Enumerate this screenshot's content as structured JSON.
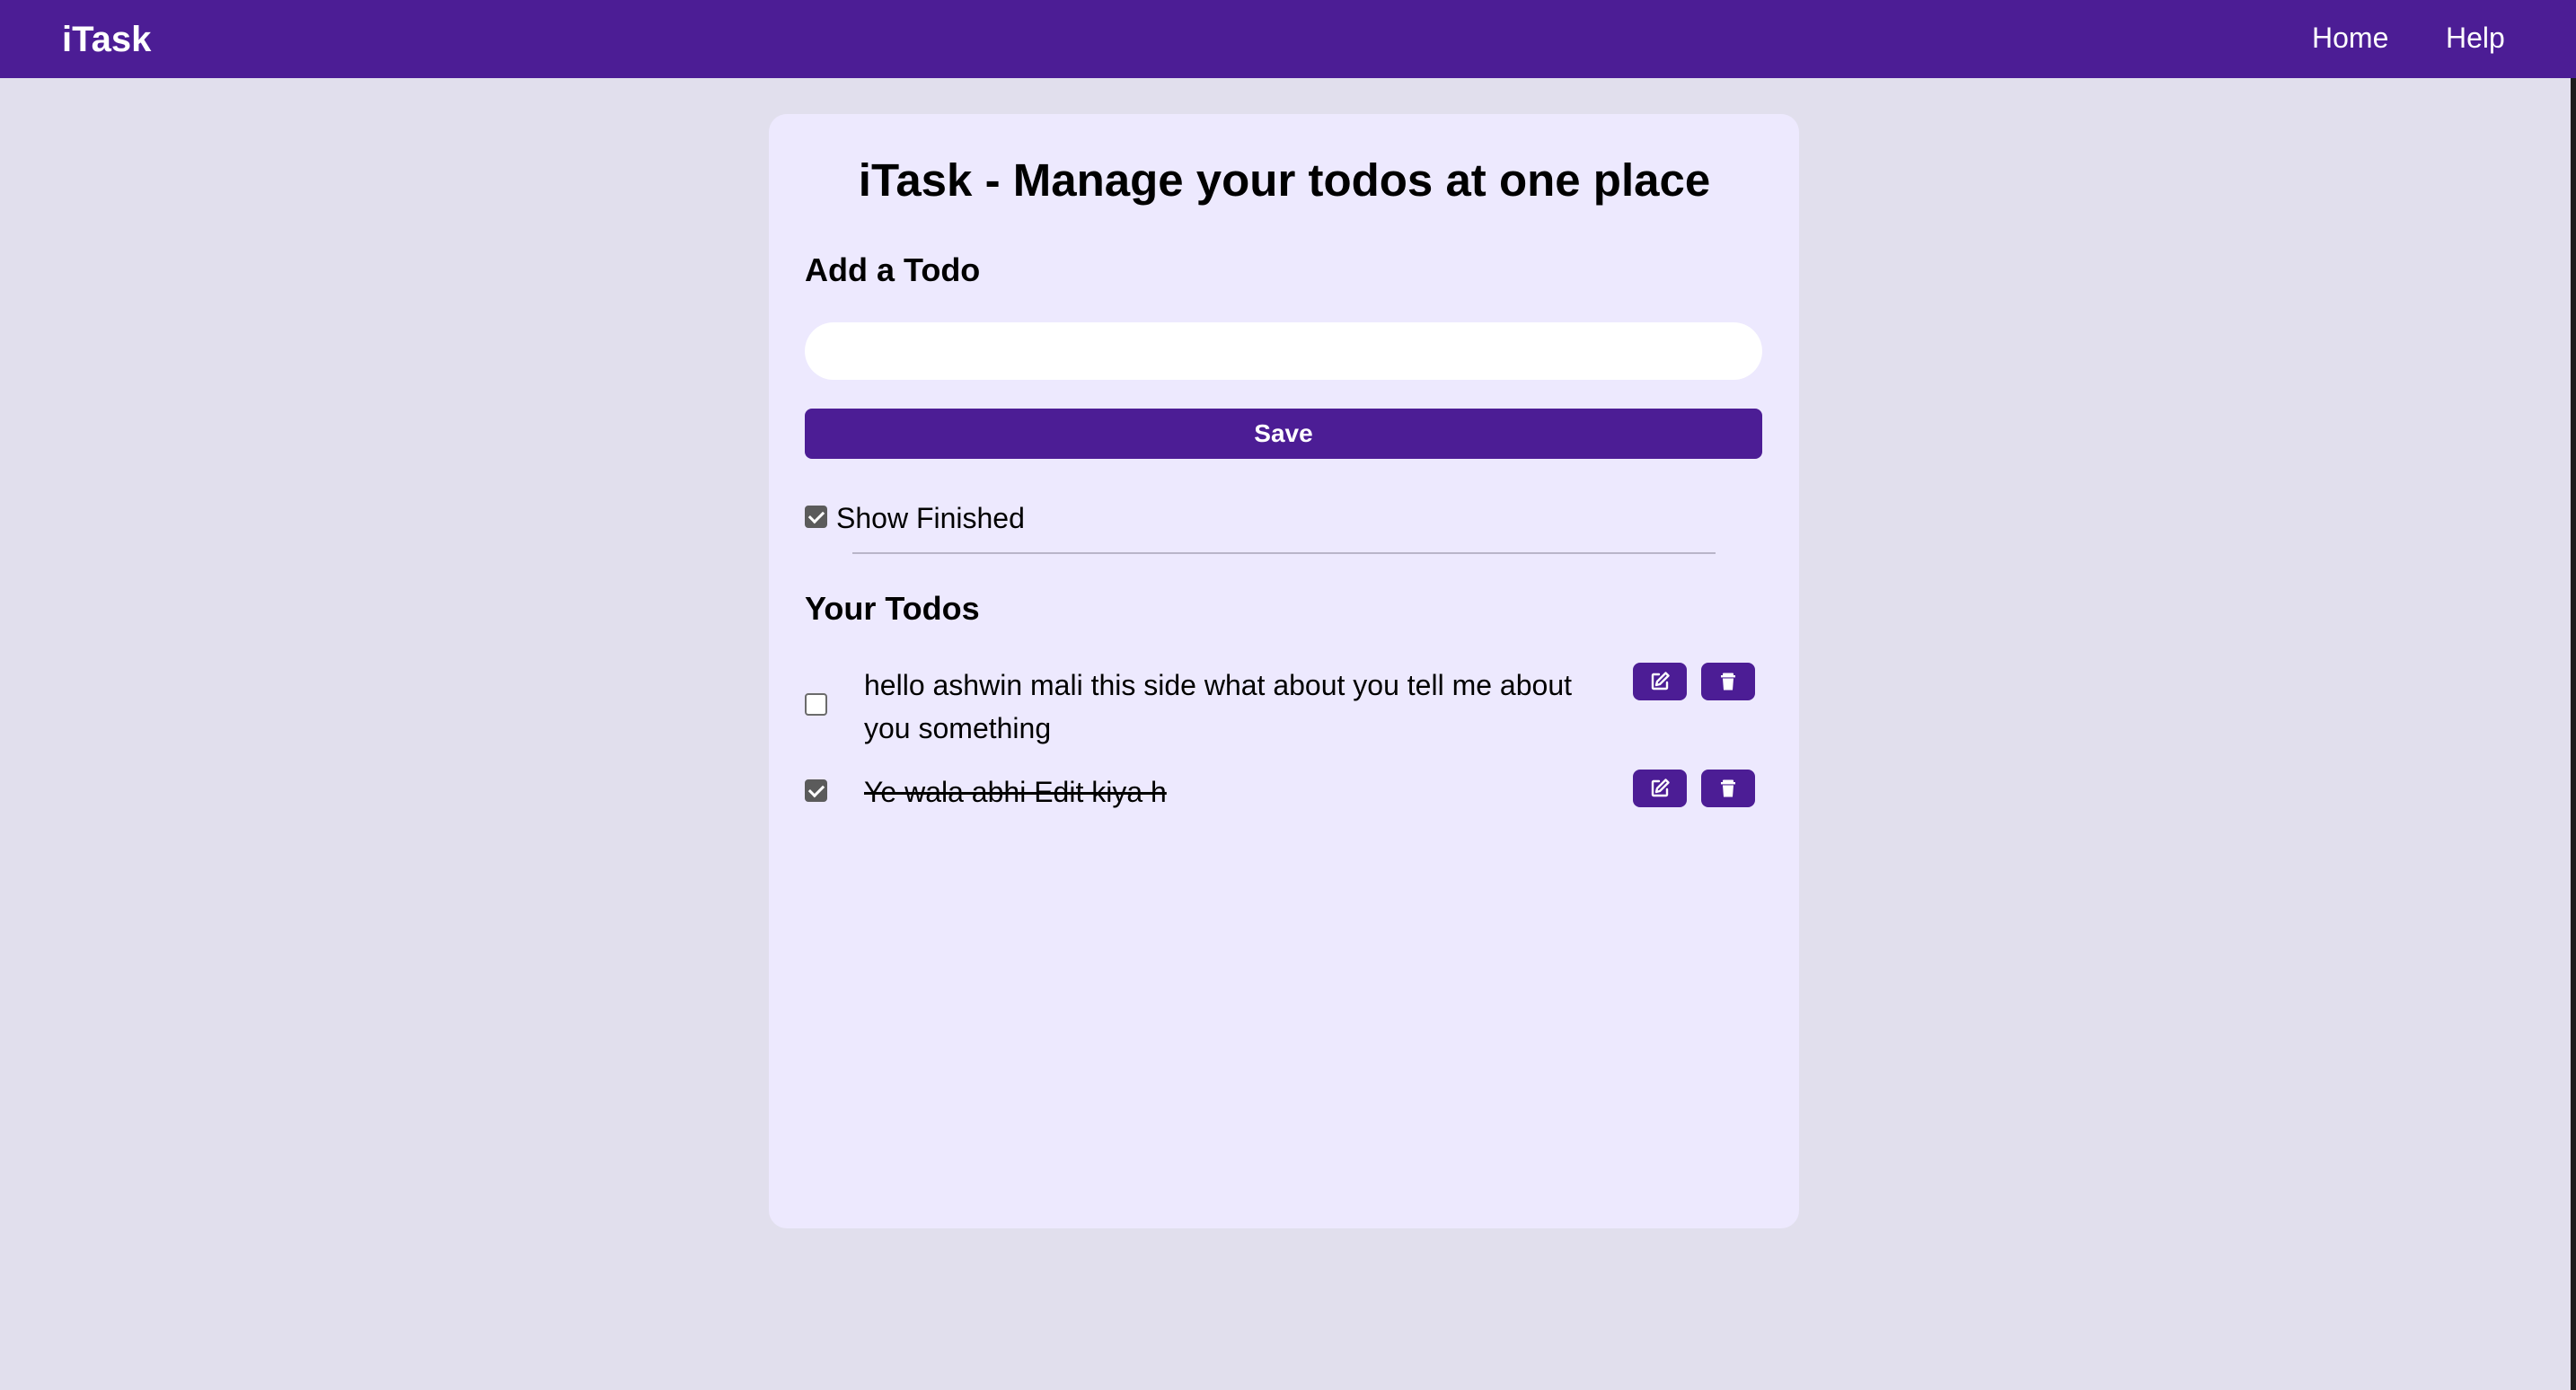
{
  "navbar": {
    "brand": "iTask",
    "links": [
      {
        "label": "Home"
      },
      {
        "label": "Help"
      }
    ],
    "bg_color": "#4c1d95"
  },
  "main": {
    "title": "iTask - Manage your todos at one place",
    "add_heading": "Add a Todo",
    "input_value": "",
    "save_label": "Save",
    "show_finished_label": "Show Finished",
    "show_finished_checked": true,
    "todos_heading": "Your Todos",
    "todos": [
      {
        "text": "hello ashwin mali this side what about you tell me about you something",
        "completed": false
      },
      {
        "text": "Ye wala abhi Edit kiya h",
        "completed": true
      }
    ]
  },
  "icons": {
    "edit": "edit-icon",
    "delete": "trash-icon"
  },
  "colors": {
    "accent": "#4c1d95",
    "card_bg": "#ede9fe",
    "page_bg": "#e1dfed"
  }
}
